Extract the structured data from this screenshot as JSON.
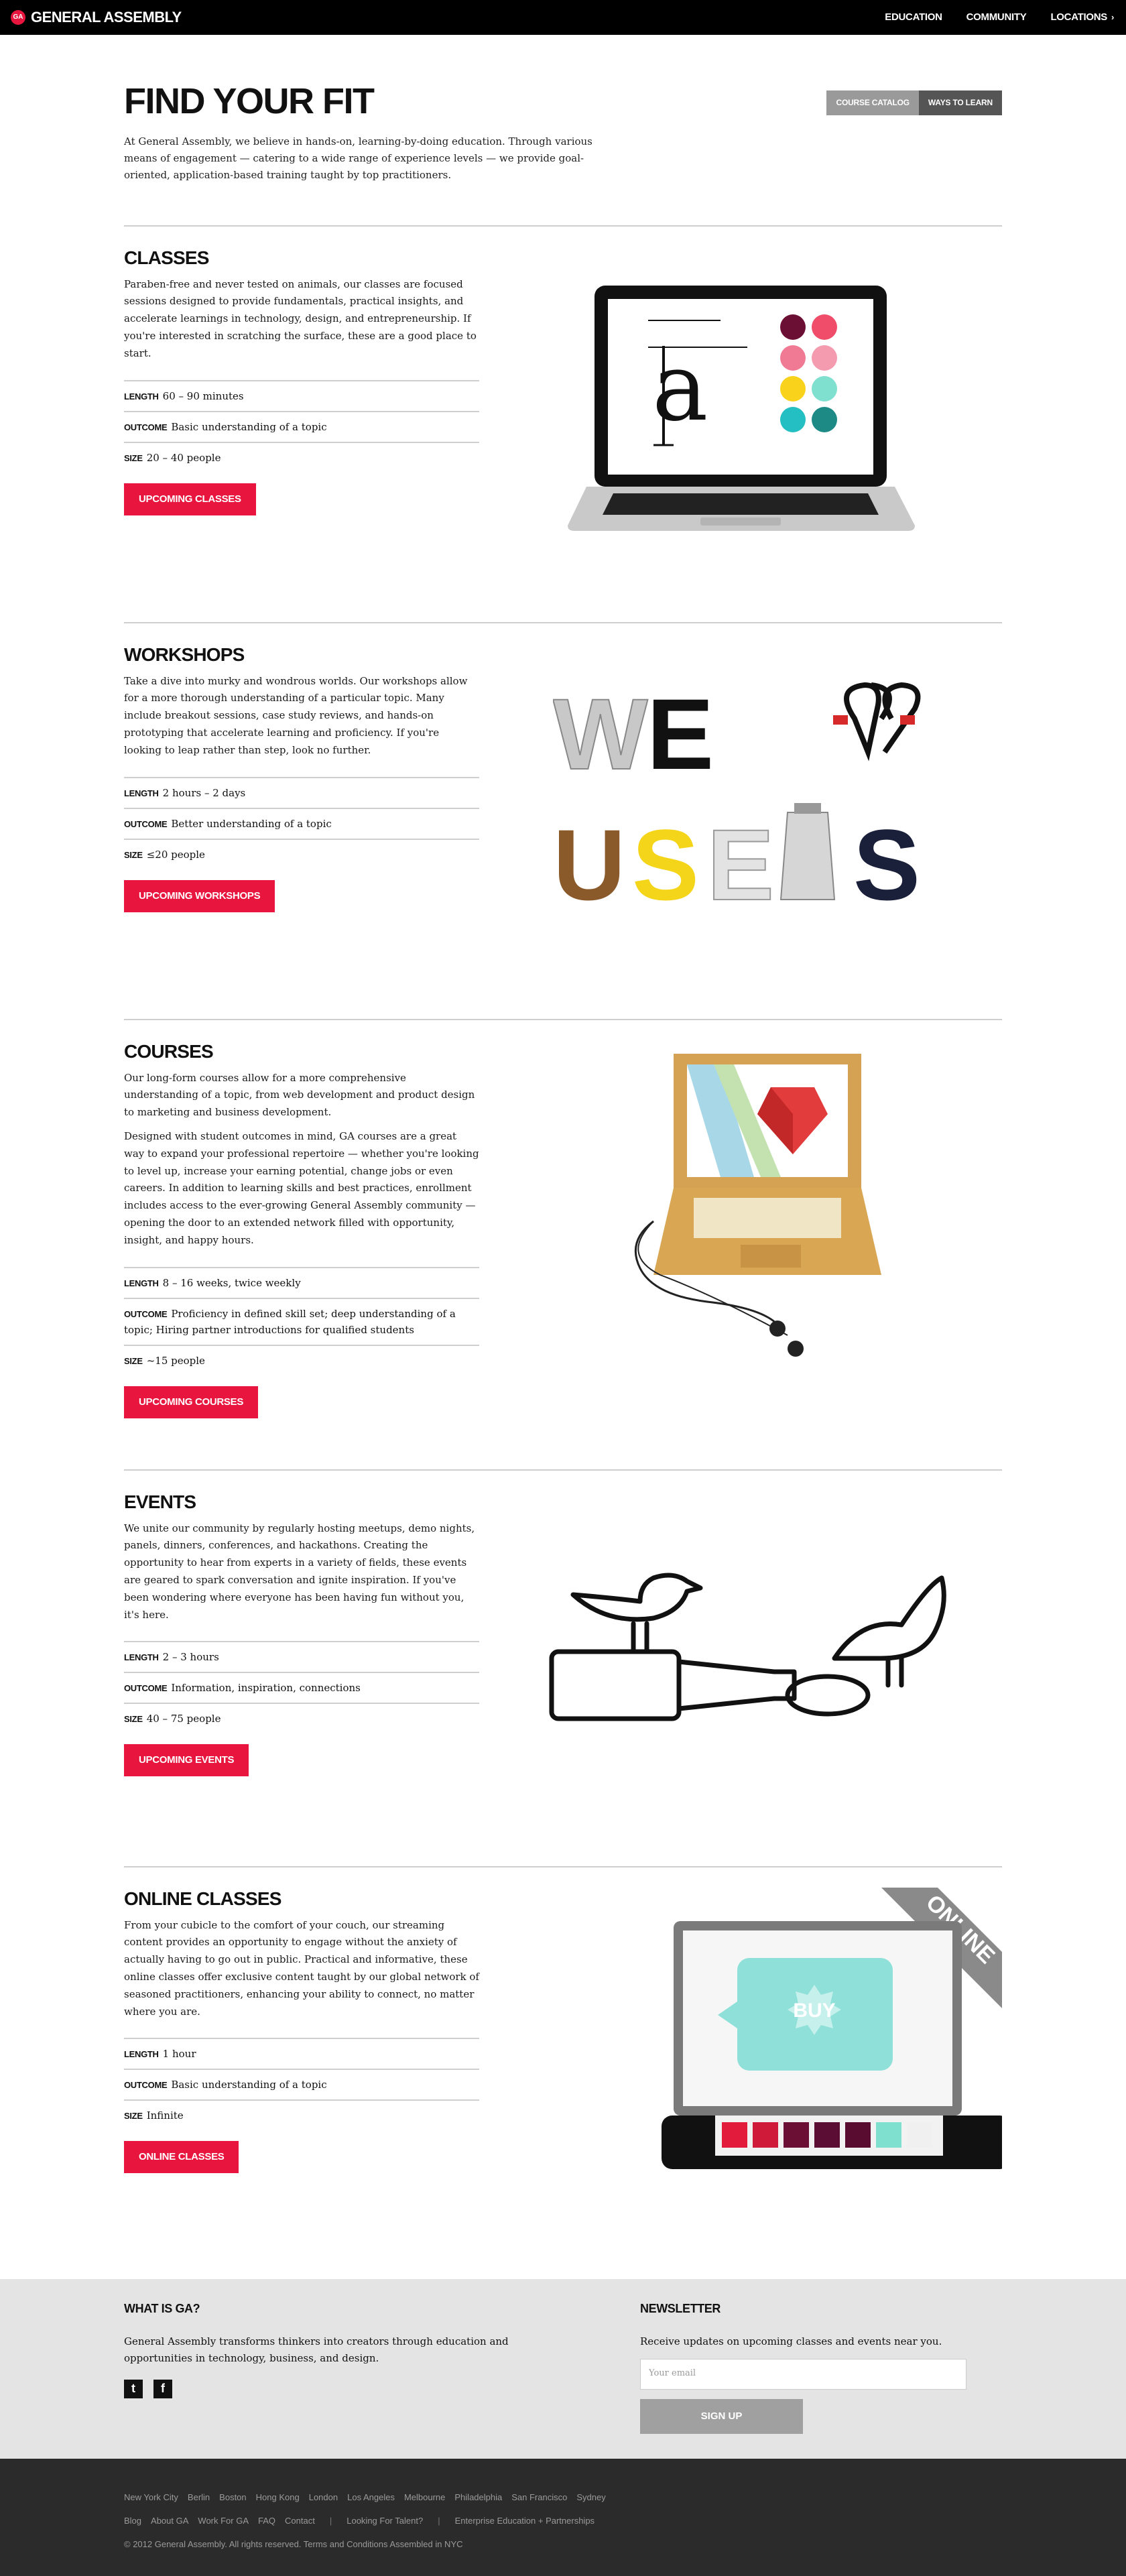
{
  "nav": {
    "brand": "GENERAL ASSEMBLY",
    "brand_mark": "GA",
    "links": [
      "EDUCATION",
      "COMMUNITY",
      "LOCATIONS"
    ]
  },
  "hero": {
    "title": "FIND YOUR FIT",
    "intro": "At General Assembly, we believe in hands-on, learning-by-doing education. Through various means of engagement — catering to a wide range of experience levels — we provide goal-oriented, application-based training taught by top practitioners.",
    "toggle": [
      "COURSE CATALOG",
      "WAYS TO LEARN"
    ]
  },
  "labels": {
    "length": "LENGTH",
    "outcome": "OUTCOME",
    "size": "SIZE"
  },
  "sections": [
    {
      "title": "CLASSES",
      "paragraphs": [
        "Paraben-free and never tested on animals, our classes are focused sessions designed to provide fundamentals, practical insights, and accelerate learnings in technology, design, and entrepreneurship. If you're interested in scratching the surface, these are a good place to start."
      ],
      "length": "60 – 90 minutes",
      "outcome": "Basic understanding of a topic",
      "size": "20 – 40 people",
      "button": "UPCOMING CLASSES"
    },
    {
      "title": "WORKSHOPS",
      "paragraphs": [
        "Take a dive into murky and wondrous worlds. Our workshops allow for a more thorough understanding of a particular topic. Many include breakout sessions, case study reviews, and hands-on prototyping that accelerate learning and proficiency. If you're looking to leap rather than step, look no further."
      ],
      "length": "2 hours – 2 days",
      "outcome": "Better understanding of a topic",
      "size": "≤20 people",
      "button": "UPCOMING WORKSHOPS"
    },
    {
      "title": "COURSES",
      "paragraphs": [
        "Our long-form courses allow for a more comprehensive understanding of a topic, from web development and product design to marketing and business development.",
        "Designed with student outcomes in mind, GA courses are a great way to expand your professional repertoire — whether you're looking to level up, increase your earning potential, change jobs or even careers. In addition to learning skills and best practices, enrollment includes access to the ever-growing General Assembly community — opening the door to an extended network filled with opportunity, insight, and happy hours."
      ],
      "length": "8 – 16 weeks, twice weekly",
      "outcome": "Proficiency in defined skill set; deep understanding of a topic; Hiring partner introductions for qualified students",
      "size": "~15 people",
      "button": "UPCOMING COURSES"
    },
    {
      "title": "EVENTS",
      "paragraphs": [
        "We unite our community by regularly hosting meetups, demo nights, panels, dinners, conferences, and hackathons. Creating the opportunity to hear from experts in a variety of fields, these events are geared to spark conversation and ignite inspiration. If you've been wondering where everyone has been having fun without you, it's here."
      ],
      "length": "2 – 3 hours",
      "outcome": "Information, inspiration, connections",
      "size": "40 – 75 people",
      "button": "UPCOMING EVENTS"
    },
    {
      "title": "ONLINE CLASSES",
      "paragraphs": [
        "From your cubicle to the comfort of your couch, our streaming content provides an opportunity to engage without the anxiety of actually having to go out in public. Practical and informative, these online classes offer exclusive content taught by our global network of seasoned practitioners, enhancing your ability to connect, no matter where you are."
      ],
      "length": "1 hour",
      "outcome": "Basic understanding of a topic",
      "size": "Infinite",
      "button": "ONLINE CLASSES"
    }
  ],
  "art": {
    "workshops_letters": [
      "W",
      "E",
      "U",
      "S",
      "E",
      "S"
    ],
    "online_banner": "ONLINE",
    "buy_label": "BUY",
    "swatches": [
      "#e21b3c",
      "#d01a3a",
      "#6b0f35",
      "#5c0d33",
      "#5a0c30",
      "#7fe0cf",
      "#f0f0f0"
    ],
    "dots": [
      "#6b0f35",
      "#f04d6a",
      "#f07a93",
      "#f49bb0",
      "#f8d21b",
      "#7fe0cf",
      "#23bfc2",
      "#1d8a86"
    ]
  },
  "footer": {
    "what_title": "WHAT IS GA?",
    "what_text": "General Assembly transforms thinkers into creators through education and opportunities in technology, business, and design.",
    "newsletter_title": "NEWSLETTER",
    "newsletter_text": "Receive updates on upcoming classes and events near you.",
    "email_placeholder": "Your email",
    "signup": "SIGN UP",
    "cities": [
      "New York City",
      "Berlin",
      "Boston",
      "Hong Kong",
      "London",
      "Los Angeles",
      "Melbourne",
      "Philadelphia",
      "San Francisco",
      "Sydney"
    ],
    "links": [
      "Blog",
      "About GA",
      "Work For GA",
      "FAQ",
      "Contact"
    ],
    "talent": "Looking For Talent?",
    "enterprise": "Enterprise Education + Partnerships",
    "copyright": "© 2012 General Assembly. All rights reserved. Terms and Conditions   Assembled in NYC"
  }
}
